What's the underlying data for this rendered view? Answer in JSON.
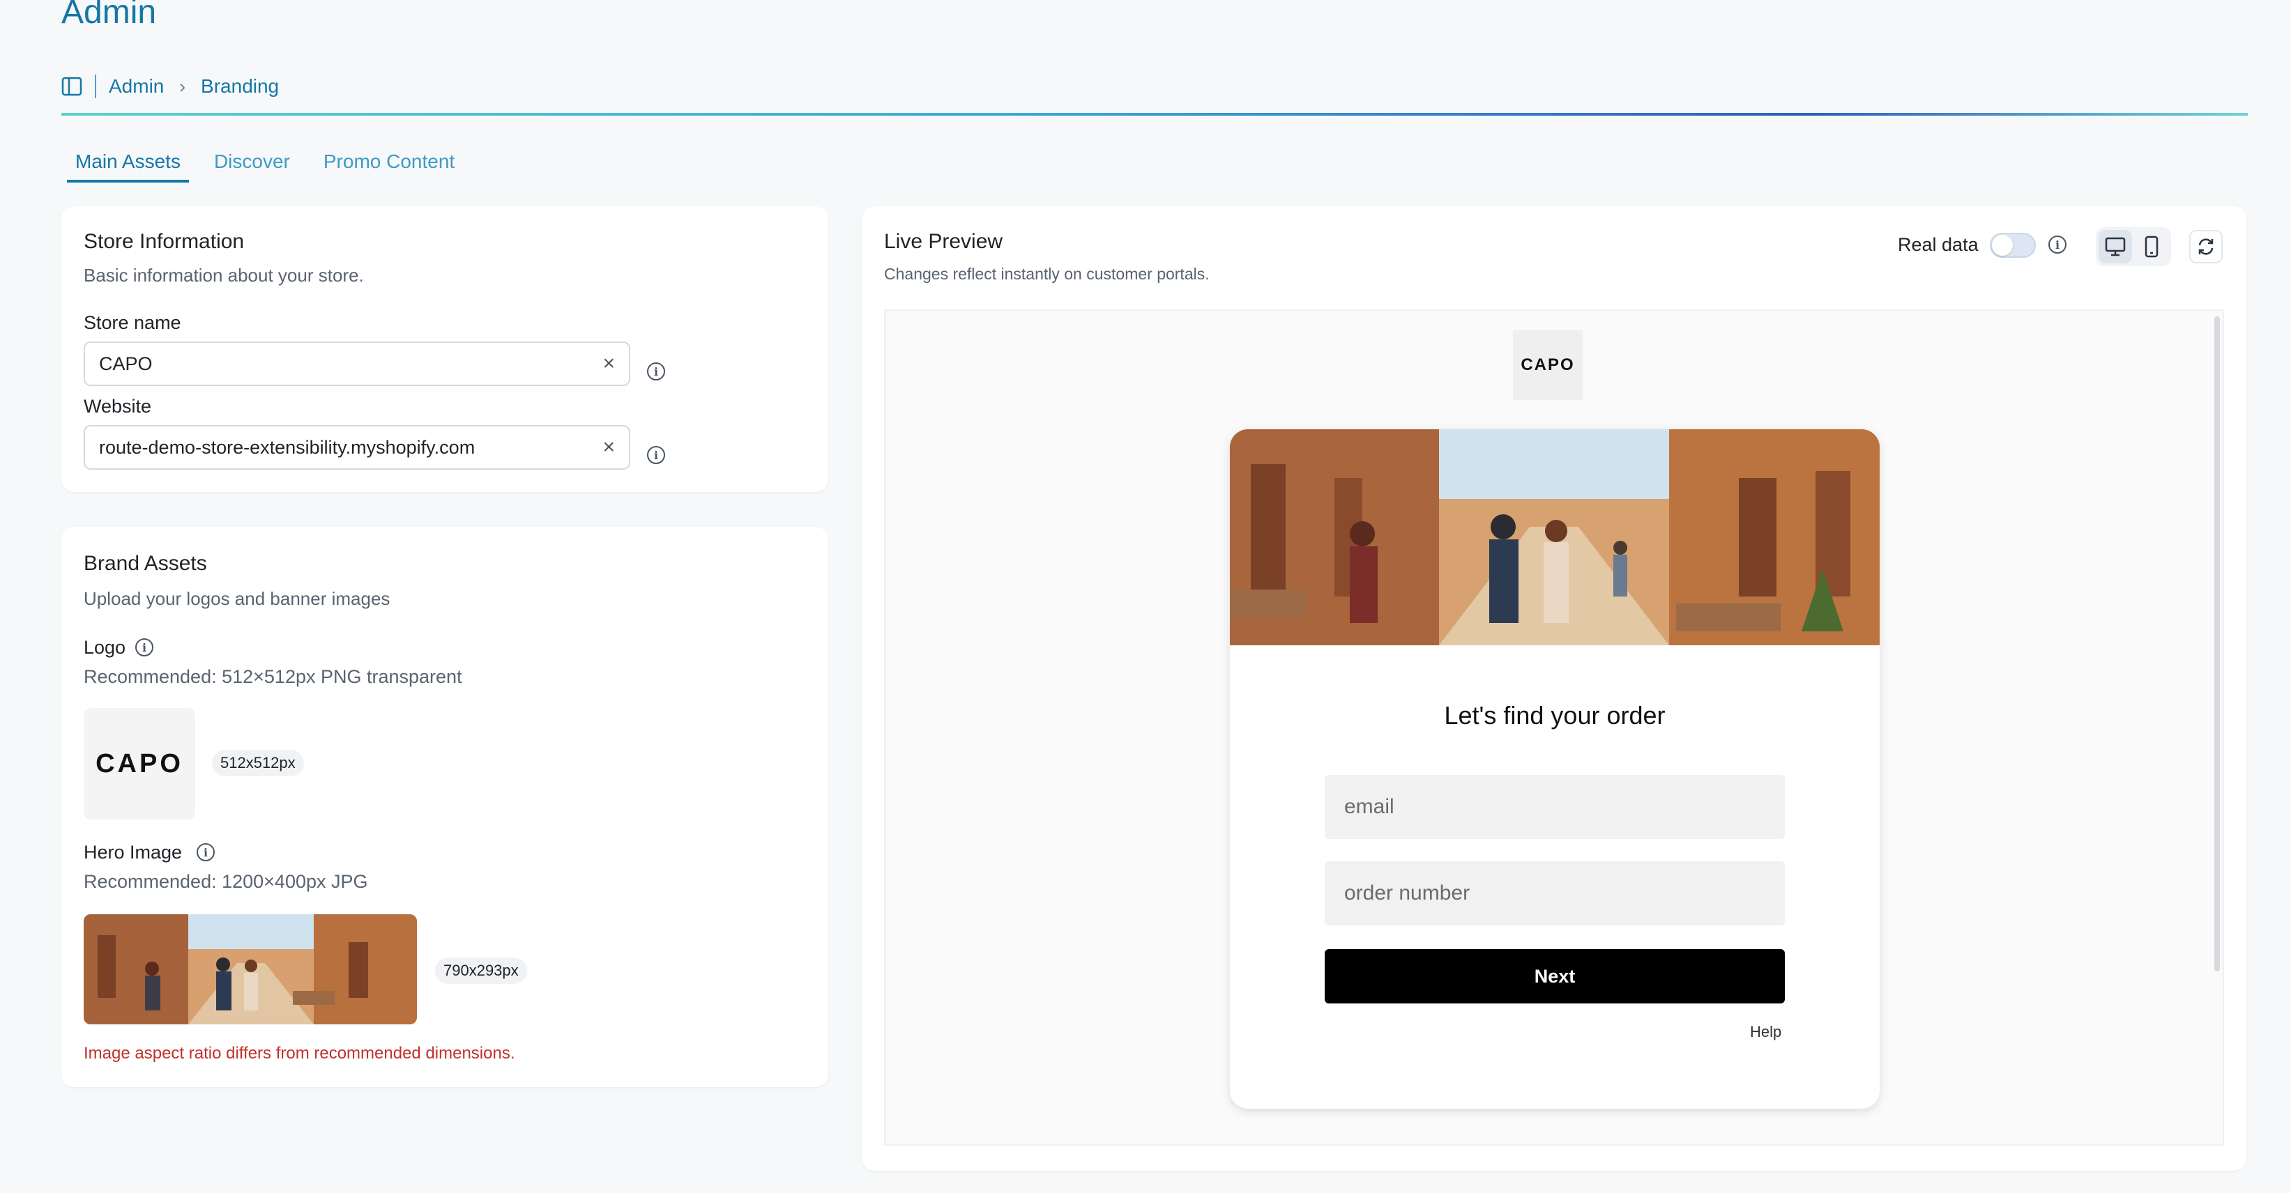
{
  "app": {
    "title": "Admin"
  },
  "breadcrumb": {
    "items": [
      "Admin",
      "Branding"
    ]
  },
  "tabs": [
    {
      "label": "Main Assets",
      "active": true
    },
    {
      "label": "Discover",
      "active": false
    },
    {
      "label": "Promo Content",
      "active": false
    }
  ],
  "store_info": {
    "title": "Store Information",
    "subtitle": "Basic information about your store.",
    "store_name_label": "Store name",
    "store_name_value": "CAPO",
    "website_label": "Website",
    "website_value": "route-demo-store-extensibility.myshopify.com"
  },
  "brand_assets": {
    "title": "Brand Assets",
    "subtitle": "Upload your logos and banner images",
    "logo_label": "Logo",
    "logo_recommendation": "Recommended: 512×512px PNG transparent",
    "logo_text": "CAPO",
    "logo_size": "512x512px",
    "hero_label": "Hero Image",
    "hero_recommendation": "Recommended: 1200×400px JPG",
    "hero_size": "790x293px",
    "warning": "Image aspect ratio differs from recommended dimensions."
  },
  "live_preview": {
    "title": "Live Preview",
    "subtitle": "Changes reflect instantly on customer portals.",
    "real_data_label": "Real data",
    "real_data_enabled": false,
    "device_selected": "desktop",
    "portal": {
      "logo_text": "CAPO",
      "heading": "Let's find your order",
      "email_placeholder": "email",
      "order_placeholder": "order number",
      "next_label": "Next",
      "help_label": "Help"
    }
  },
  "colors": {
    "accent": "#1477a6",
    "error": "#c0312b",
    "button_black": "#000000"
  },
  "icons": [
    "sidebar-toggle-icon",
    "chevron-right-icon",
    "clear-icon",
    "info-icon",
    "desktop-icon",
    "mobile-icon",
    "refresh-icon"
  ]
}
